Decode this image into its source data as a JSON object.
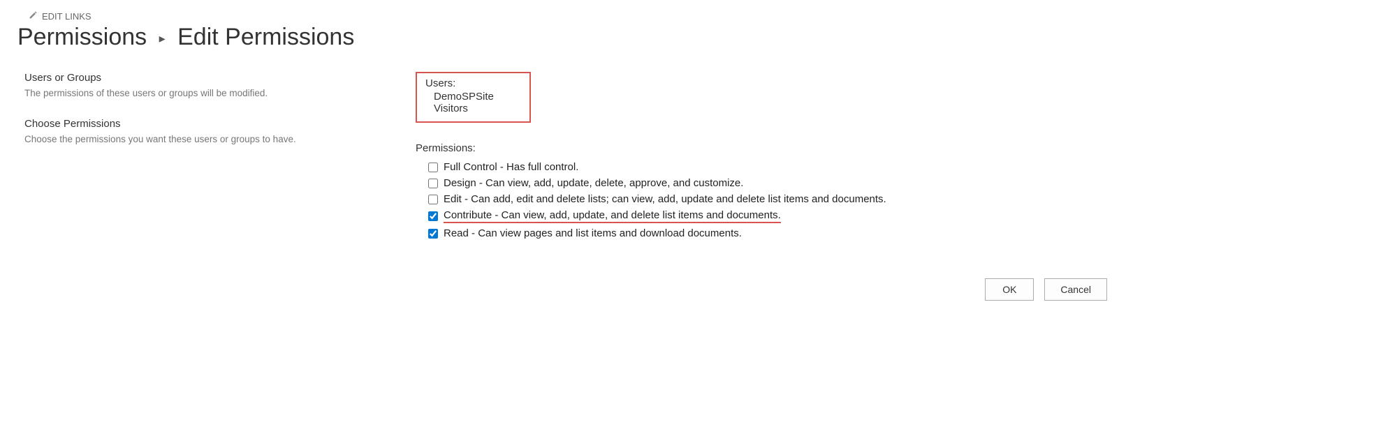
{
  "header": {
    "edit_links_label": "EDIT LINKS",
    "crumb_parent": "Permissions",
    "crumb_current": "Edit Permissions"
  },
  "users_section": {
    "heading": "Users or Groups",
    "desc": "The permissions of these users or groups will be modified.",
    "label": "Users:",
    "value": "DemoSPSite Visitors"
  },
  "perm_section": {
    "heading": "Choose Permissions",
    "desc": "Choose the permissions you want these users or groups to have.",
    "label": "Permissions:",
    "items": [
      {
        "label": "Full Control - Has full control.",
        "checked": false
      },
      {
        "label": "Design - Can view, add, update, delete, approve, and customize.",
        "checked": false
      },
      {
        "label": "Edit - Can add, edit and delete lists; can view, add, update and delete list items and documents.",
        "checked": false
      },
      {
        "label": "Contribute - Can view, add, update, and delete list items and documents.",
        "checked": true,
        "highlight": true
      },
      {
        "label": "Read - Can view pages and list items and download documents.",
        "checked": true
      }
    ]
  },
  "buttons": {
    "ok": "OK",
    "cancel": "Cancel"
  }
}
